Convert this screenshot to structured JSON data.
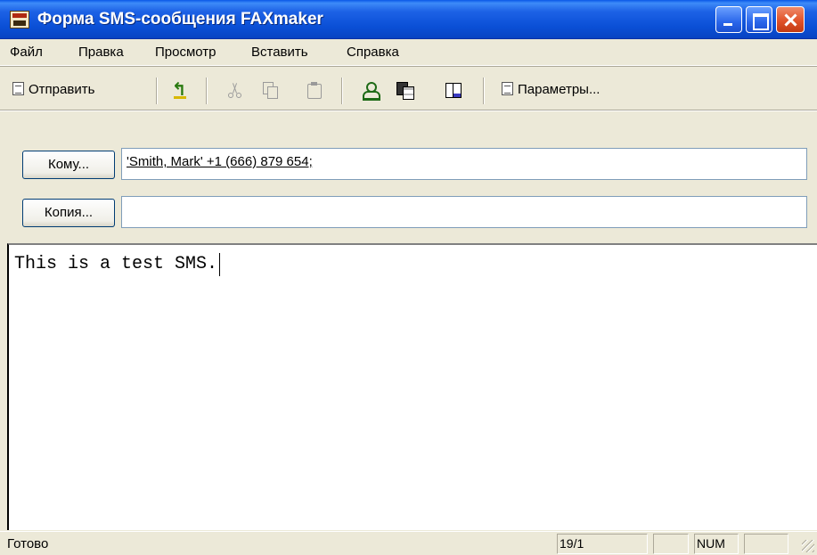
{
  "window": {
    "title": "Форма SMS-сообщения FAXmaker"
  },
  "menu": {
    "items": [
      {
        "label": "Файл"
      },
      {
        "label": "Правка"
      },
      {
        "label": "Просмотр"
      },
      {
        "label": "Вставить"
      },
      {
        "label": "Справка"
      }
    ]
  },
  "toolbar": {
    "send_label": "Отправить",
    "options_label": "Параметры..."
  },
  "addressing": {
    "to_button": "Кому...",
    "to_value": "'Smith, Mark' +1 (666) 879 654;",
    "cc_button": "Копия...",
    "cc_value": ""
  },
  "message": {
    "body": "This is a test SMS."
  },
  "status": {
    "text": "Готово",
    "position": "19/1",
    "num": "NUM"
  }
}
